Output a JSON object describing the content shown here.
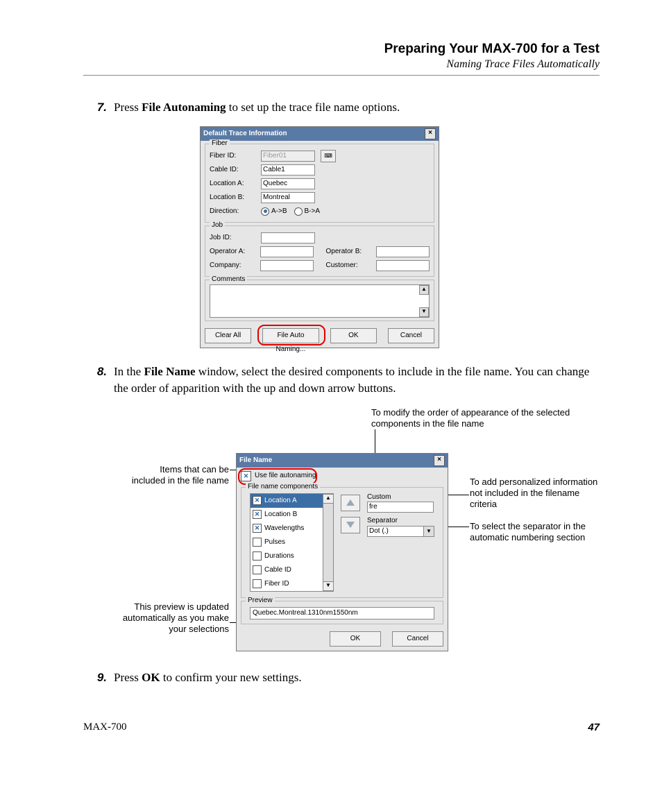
{
  "header": {
    "title": "Preparing Your MAX-700 for a Test",
    "subtitle": "Naming Trace Files Automatically"
  },
  "steps": {
    "s7": {
      "num": "7.",
      "text_a": "Press ",
      "bold": "File Autonaming",
      "text_b": " to set up the trace file name options."
    },
    "s8": {
      "num": "8.",
      "text_a": "In the ",
      "bold": "File Name",
      "text_b": " window, select the desired components to include in the file name. You can change the order of apparition with the up and down arrow buttons."
    },
    "s9": {
      "num": "9.",
      "text_a": "Press ",
      "bold": "OK",
      "text_b": " to confirm your new settings."
    }
  },
  "dialog1": {
    "title": "Default Trace Information",
    "groups": {
      "fiber": {
        "legend": "Fiber",
        "fiber_id_lbl": "Fiber ID:",
        "fiber_id_val": "Fiber01",
        "cable_id_lbl": "Cable ID:",
        "cable_id_val": "Cable1",
        "loc_a_lbl": "Location A:",
        "loc_a_val": "Quebec",
        "loc_b_lbl": "Location B:",
        "loc_b_val": "Montreal",
        "dir_lbl": "Direction:",
        "dir_ab": "A->B",
        "dir_ba": "B->A"
      },
      "job": {
        "legend": "Job",
        "job_id_lbl": "Job ID:",
        "op_a_lbl": "Operator A:",
        "op_b_lbl": "Operator B:",
        "company_lbl": "Company:",
        "customer_lbl": "Customer:"
      },
      "comments": {
        "legend": "Comments"
      }
    },
    "buttons": {
      "clear": "Clear All",
      "auto": "File Auto Naming...",
      "ok": "OK",
      "cancel": "Cancel"
    }
  },
  "annotations": {
    "top": "To modify the order of appearance of the selected components in the file name",
    "left1": "Items that can be included in the file name",
    "right1": "To add personalized information not included in the filename criteria",
    "right2": "To select the separator in the automatic numbering section",
    "left2": "This preview is updated automatically as you make your selections"
  },
  "dialog2": {
    "title": "File Name",
    "use_auto": "Use file autonaming",
    "group": "File name components",
    "items": [
      {
        "label": "Location A",
        "checked": true,
        "selected": true
      },
      {
        "label": "Location B",
        "checked": true,
        "selected": false
      },
      {
        "label": "Wavelengths",
        "checked": true,
        "selected": false
      },
      {
        "label": "Pulses",
        "checked": false,
        "selected": false
      },
      {
        "label": "Durations",
        "checked": false,
        "selected": false
      },
      {
        "label": "Cable ID",
        "checked": false,
        "selected": false
      },
      {
        "label": "Fiber ID",
        "checked": false,
        "selected": false
      }
    ],
    "custom_lbl": "Custom",
    "custom_val": "fre",
    "sep_lbl": "Separator",
    "sep_val": "Dot (.)",
    "preview_lbl": "Preview",
    "preview_val": "Quebec.Montreal.1310nm1550nm",
    "ok": "OK",
    "cancel": "Cancel"
  },
  "footer": {
    "model": "MAX-700",
    "page": "47"
  }
}
